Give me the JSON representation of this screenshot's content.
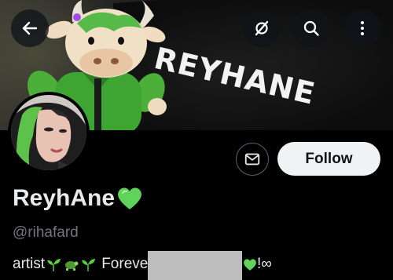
{
  "header": {
    "banner_text": "REYHANE",
    "back_icon": "arrow-left-icon",
    "grok_icon": "grok-icon",
    "search_icon": "search-icon",
    "more_icon": "more-vertical-icon"
  },
  "profile": {
    "display_name": "ReyhAne",
    "name_emoji": "💚",
    "handle": "@rihafard",
    "bio_start": "artist",
    "bio_middle": "Forever a",
    "bio_end": "!∞",
    "bio_emojis": [
      "seedling",
      "turtle",
      "seedling",
      "green-heart"
    ]
  },
  "actions": {
    "message_icon": "envelope-icon",
    "follow_label": "Follow"
  },
  "colors": {
    "background": "#000000",
    "text_primary": "#e7e9ea",
    "text_secondary": "#71767b",
    "follow_bg": "#eff3f4",
    "accent_green": "#5fd35a"
  }
}
